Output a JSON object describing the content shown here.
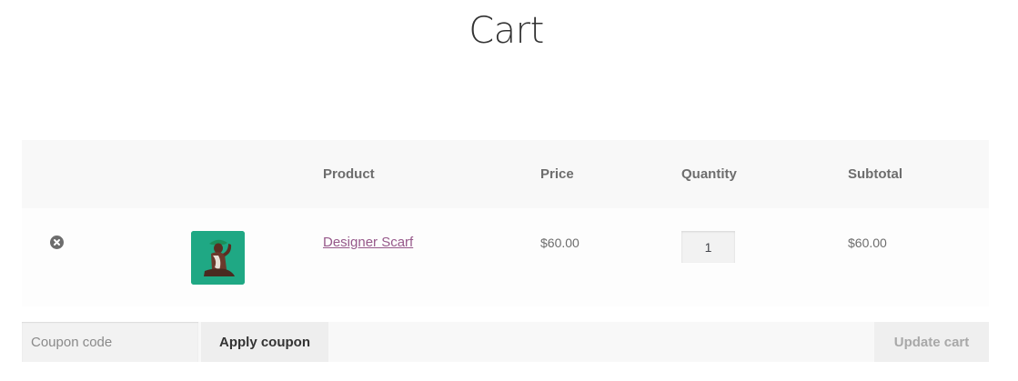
{
  "page": {
    "title": "Cart"
  },
  "cart": {
    "columns": {
      "product": "Product",
      "price": "Price",
      "quantity": "Quantity",
      "subtotal": "Subtotal"
    },
    "items": [
      {
        "name": "Designer Scarf",
        "price": "$60.00",
        "quantity": "1",
        "subtotal": "$60.00",
        "thumbnail_icon": "product-thumbnail-scarf",
        "remove_icon": "remove-circle-x-icon"
      }
    ]
  },
  "coupon": {
    "placeholder": "Coupon code",
    "apply_label": "Apply coupon"
  },
  "actions": {
    "update_label": "Update cart"
  },
  "colors": {
    "link": "#96588a",
    "header_bg": "#f8f8f8",
    "thumbnail_bg": "#1fa884"
  }
}
